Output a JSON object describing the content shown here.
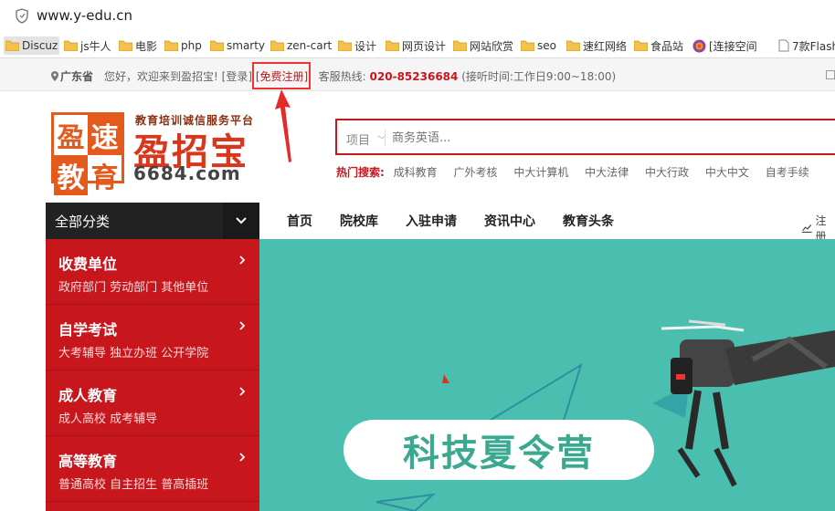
{
  "browser": {
    "url": "www.y-edu.cn",
    "bookmarks": [
      "Discuz",
      "js牛人",
      "电影",
      "php",
      "smarty",
      "zen-cart",
      "设计",
      "网页设计",
      "网站欣赏",
      "seo",
      "速红网络",
      "食品站",
      "[连接空间",
      "7款Flash"
    ]
  },
  "topbar": {
    "location": "广东省",
    "welcome": "您好，欢迎来到盈招宝!",
    "login": "[登录]",
    "register": "[免费注册]",
    "hotline_label": "客服热线:",
    "hotline": "020-85236684",
    "hours": "(接听时间:工作日9:00~18:00)"
  },
  "brand": {
    "logo_chars": [
      "盈",
      "速",
      "教",
      "育"
    ],
    "tagline": "教育培训诚信服务平台",
    "name": "盈招宝",
    "domain": "6684.com"
  },
  "search": {
    "category": "项目",
    "placeholder": "商务英语...",
    "hot_label": "热门搜索:",
    "hot_keywords": [
      "成科教育",
      "广外考核",
      "中大计算机",
      "中大法律",
      "中大行政",
      "中大中文",
      "自考手续"
    ]
  },
  "nav": {
    "all_categories": "全部分类",
    "items": [
      "首页",
      "院校库",
      "入驻申请",
      "资讯中心",
      "教育头条"
    ],
    "right_label": "注册"
  },
  "sidebar": {
    "items": [
      {
        "title": "收费单位",
        "sub": "政府部门 劳动部门 其他单位"
      },
      {
        "title": "自学考试",
        "sub": "大考辅导 独立办班 公开学院"
      },
      {
        "title": "成人教育",
        "sub": "成人高校 成考辅导"
      },
      {
        "title": "高等教育",
        "sub": "普通高校 自主招生 普高插班"
      }
    ]
  },
  "banner": {
    "title": "科技夏令营"
  },
  "colors": {
    "brand_red": "#c8161d",
    "banner_teal": "#4bbfaf",
    "logo_orange": "#e35a1c"
  }
}
